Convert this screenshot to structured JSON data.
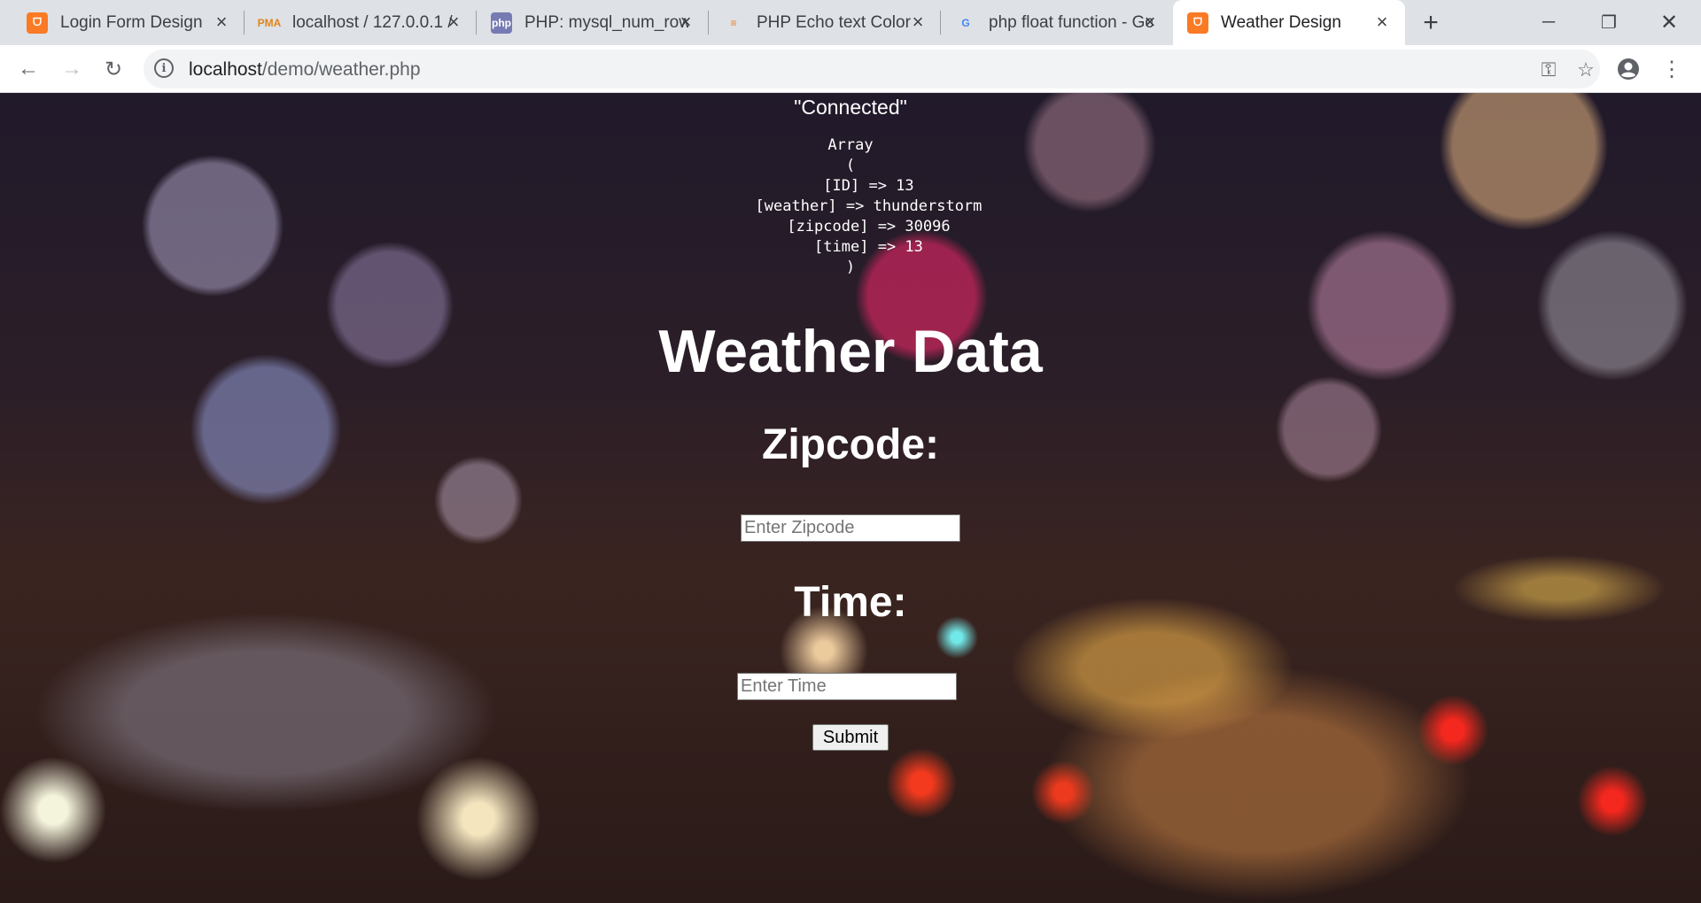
{
  "browser": {
    "tabs": [
      {
        "title": "Login Form Design",
        "favicon": "xampp-icon",
        "active": false
      },
      {
        "title": "localhost / 127.0.0.1 /",
        "favicon": "phpmyadmin-icon",
        "active": false
      },
      {
        "title": "PHP: mysql_num_rows",
        "favicon": "php-icon",
        "active": false
      },
      {
        "title": "PHP Echo text Color",
        "favicon": "stackoverflow-icon",
        "active": false
      },
      {
        "title": "php float function - Go",
        "favicon": "google-icon",
        "active": false
      },
      {
        "title": "Weather Design",
        "favicon": "xampp-icon",
        "active": true
      }
    ],
    "address": {
      "host": "localhost",
      "path": "/demo/weather.php"
    }
  },
  "page": {
    "connected_text": "\"Connected\"",
    "array_dump": "Array\n(\n    [ID] => 13\n    [weather] => thunderstorm\n    [zipcode] => 30096\n    [time] => 13\n)",
    "heading": "Weather Data",
    "zipcode_label": "Zipcode:",
    "zipcode_placeholder": "Enter Zipcode",
    "time_label": "Time:",
    "time_placeholder": "Enter Time",
    "submit_label": "Submit"
  }
}
